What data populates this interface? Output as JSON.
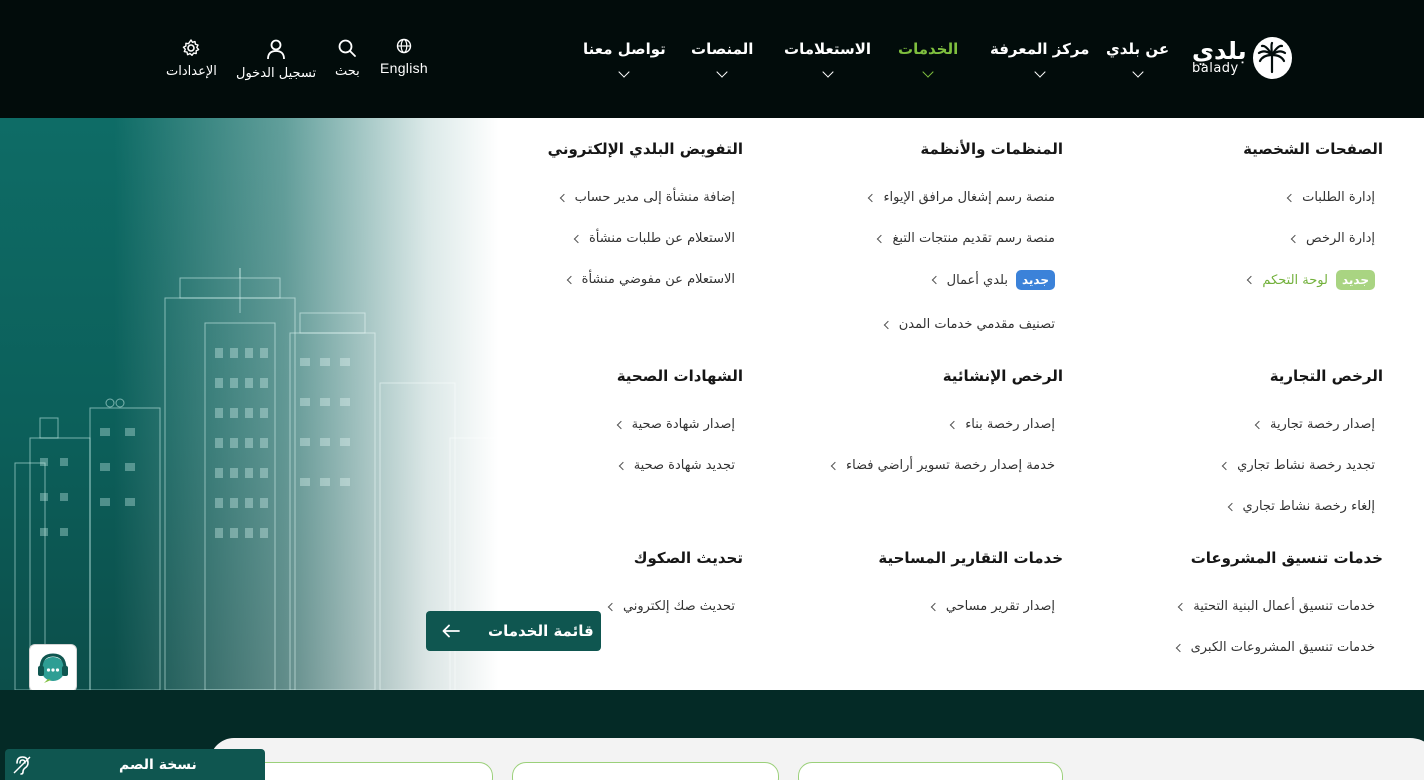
{
  "brand": {
    "name_ar": "بلدي",
    "name_en": "balady"
  },
  "nav": [
    {
      "label": "عن بلدي"
    },
    {
      "label": "مركز المعرفة"
    },
    {
      "label": "الخدمات",
      "active": true
    },
    {
      "label": "الاستعلامات"
    },
    {
      "label": "المنصات"
    },
    {
      "label": "تواصل معنا"
    }
  ],
  "utilities": {
    "language": "English",
    "search": "بحث",
    "login": "تسجيل الدخول",
    "settings": "الإعدادات"
  },
  "mega_menu": {
    "columns": [
      {
        "title": "الصفحات الشخصية",
        "items": [
          {
            "label": "إدارة الطلبات"
          },
          {
            "label": "إدارة الرخص"
          },
          {
            "label": "لوحة التحكم",
            "badge": "جديد"
          }
        ]
      },
      {
        "title": "المنظمات والأنظمة",
        "items": [
          {
            "label": "منصة رسم إشغال مرافق الإيواء"
          },
          {
            "label": "منصة رسم تقديم منتجات التبغ"
          },
          {
            "label": "بلدي أعمال",
            "badge": "جديد"
          },
          {
            "label": "تصنيف مقدمي خدمات المدن"
          }
        ]
      },
      {
        "title": "التفويض البلدي الإلكتروني",
        "items": [
          {
            "label": "إضافة منشأة إلى مدير حساب"
          },
          {
            "label": "الاستعلام عن طلبات منشأة"
          },
          {
            "label": "الاستعلام عن مفوضي منشأة"
          }
        ]
      },
      {
        "title": "الرخص التجارية",
        "items": [
          {
            "label": "إصدار رخصة تجارية"
          },
          {
            "label": "تجديد رخصة نشاط تجاري"
          },
          {
            "label": "إلغاء رخصة نشاط تجاري"
          }
        ]
      },
      {
        "title": "الرخص الإنشائية",
        "items": [
          {
            "label": "إصدار رخصة بناء"
          },
          {
            "label": "خدمة إصدار رخصة تسوير أراضي فضاء"
          }
        ]
      },
      {
        "title": "الشهادات الصحية",
        "items": [
          {
            "label": "إصدار شهادة صحية"
          },
          {
            "label": "تجديد شهادة صحية"
          }
        ]
      },
      {
        "title": "خدمات تنسيق المشروعات",
        "items": [
          {
            "label": "خدمات تنسيق أعمال البنية التحتية"
          },
          {
            "label": "خدمات تنسيق المشروعات الكبرى"
          }
        ]
      },
      {
        "title": "خدمات التقارير المساحية",
        "items": [
          {
            "label": "إصدار تقرير مساحي"
          }
        ]
      },
      {
        "title": "تحديث الصكوك",
        "items": [
          {
            "label": "تحديث صك إلكتروني"
          }
        ]
      }
    ],
    "services_list_button": "قائمة الخدمات"
  },
  "accessibility": {
    "deaf_version": "نسخة الصم"
  },
  "colors": {
    "header_bg": "#020c0b",
    "active_green": "#7fbf3f",
    "primary_teal": "#0f5650",
    "badge_blue": "#3b82d9",
    "badge_green": "#a9d482"
  }
}
